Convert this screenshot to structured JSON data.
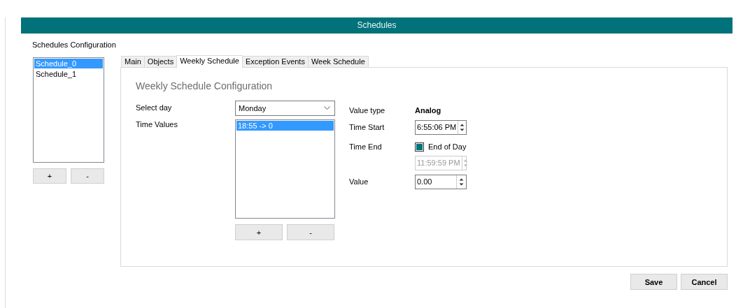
{
  "window": {
    "title": "Schedules"
  },
  "sidebar": {
    "label": "Schedules Configuration",
    "items": [
      {
        "label": "Schedule_0",
        "selected": true
      },
      {
        "label": "Schedule_1",
        "selected": false
      }
    ],
    "buttons": [
      "+",
      "-"
    ]
  },
  "tabs": [
    {
      "label": "Main",
      "selected": false
    },
    {
      "label": "Objects",
      "selected": false
    },
    {
      "label": "Weekly Schedule",
      "selected": true
    },
    {
      "label": "Exception Events",
      "selected": false
    },
    {
      "label": "Week Schedule",
      "selected": false
    }
  ],
  "weekly": {
    "heading": "Weekly Schedule Configuration",
    "select_day": {
      "label": "Select day",
      "value": "Monday"
    },
    "time_values": {
      "label": "Time Values",
      "items": [
        {
          "label": "18:55 -> 0",
          "selected": true
        }
      ],
      "buttons": [
        "+",
        "-"
      ]
    },
    "value_type": {
      "label": "Value type",
      "value": "Analog"
    },
    "time_start": {
      "label": "Time Start",
      "value": "6:55:06 PM",
      "disabled": false
    },
    "time_end": {
      "label": "Time End",
      "end_of_day": {
        "label": "End of Day",
        "checked": true
      },
      "value": "11:59:59 PM",
      "disabled": true
    },
    "value": {
      "label": "Value",
      "value": "0.00",
      "disabled": false
    }
  },
  "footer_buttons": [
    "Save",
    "Cancel"
  ]
}
